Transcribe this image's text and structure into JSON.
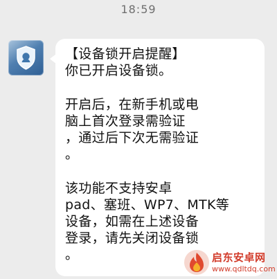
{
  "status_bar": {
    "time": "18:59"
  },
  "sender": {
    "avatar_icon": "qq-shield-icon"
  },
  "message": {
    "text": "【设备锁开启提醒】\n你已开启设备锁。\n\n开启后，在新手机或电\n脑上首次登录需验证\n，通过后下次无需验证\n。\n\n该功能不支持安卓\npad、塞班、WP7、MTK等\n设备，如需在上述设备\n登录，请先关闭设备锁\n。"
  },
  "watermark": {
    "name": "启东安卓网",
    "url": "www.qdltdq.com",
    "logo_icon": "flame-logo-icon"
  },
  "colors": {
    "background": "#ececec",
    "bubble": "#ffffff",
    "watermark": "#d23c2b"
  }
}
